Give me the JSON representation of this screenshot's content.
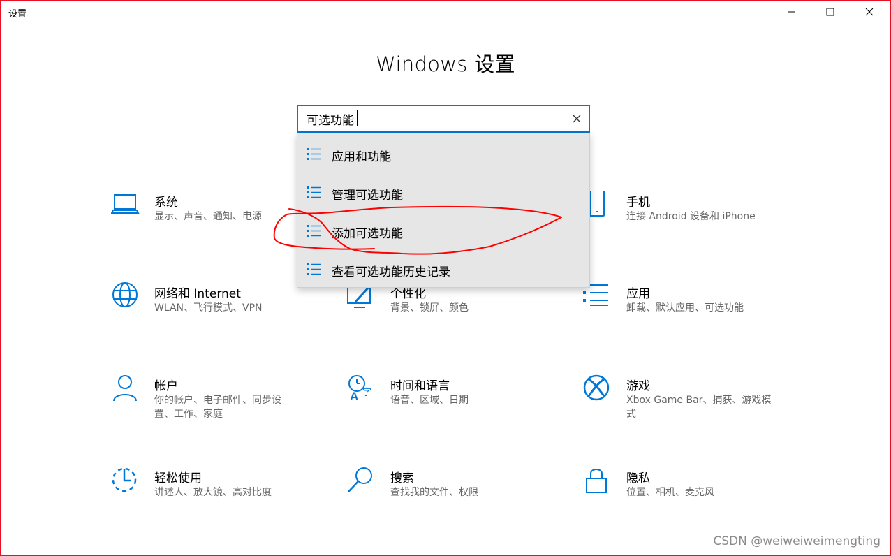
{
  "window": {
    "title": "设置",
    "controls": [
      "minimize-icon",
      "maximize-icon",
      "close-icon"
    ]
  },
  "page": {
    "title": "Windows 设置"
  },
  "search": {
    "value": "可选功能",
    "clear_icon": "close-icon"
  },
  "suggestions": [
    {
      "label": "应用和功能",
      "icon": "list-icon"
    },
    {
      "label": "管理可选功能",
      "icon": "list-icon"
    },
    {
      "label": "添加可选功能",
      "icon": "list-icon"
    },
    {
      "label": "查看可选功能历史记录",
      "icon": "list-icon"
    }
  ],
  "tiles": {
    "system": {
      "title": "系统",
      "desc": "显示、声音、通知、电源",
      "icon": "laptop-icon"
    },
    "phone": {
      "title": "手机",
      "desc": "连接 Android 设备和 iPhone",
      "icon": "phone-icon"
    },
    "network": {
      "title": "网络和 Internet",
      "desc": "WLAN、飞行模式、VPN",
      "icon": "globe-icon"
    },
    "personalization": {
      "title": "个性化",
      "desc": "背景、锁屏、颜色",
      "icon": "paint-icon"
    },
    "apps": {
      "title": "应用",
      "desc": "卸载、默认应用、可选功能",
      "icon": "list-icon"
    },
    "accounts": {
      "title": "帐户",
      "desc": "你的帐户、电子邮件、同步设置、工作、家庭",
      "icon": "person-icon"
    },
    "time": {
      "title": "时间和语言",
      "desc": "语音、区域、日期",
      "icon": "time-language-icon"
    },
    "gaming": {
      "title": "游戏",
      "desc": "Xbox Game Bar、捕获、游戏模式",
      "icon": "xbox-icon"
    },
    "ease": {
      "title": "轻松使用",
      "desc": "讲述人、放大镜、高对比度",
      "icon": "ease-of-access-icon"
    },
    "search": {
      "title": "搜索",
      "desc": "查找我的文件、权限",
      "icon": "search-icon"
    },
    "privacy": {
      "title": "隐私",
      "desc": "位置、相机、麦克风",
      "icon": "lock-icon"
    }
  },
  "watermark": "CSDN @weiweiweimengting",
  "colors": {
    "accent": "#0078d7",
    "annotation": "#ff0000"
  }
}
